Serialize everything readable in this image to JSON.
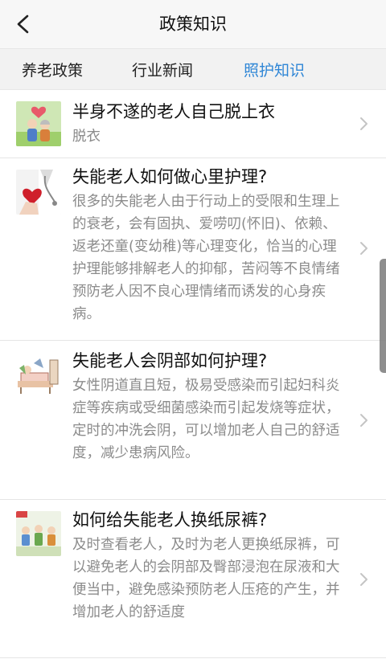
{
  "header": {
    "title": "政策知识",
    "back_icon": "chevron-left-icon"
  },
  "tabs": [
    {
      "label": "养老政策",
      "active": false
    },
    {
      "label": "行业新闻",
      "active": false
    },
    {
      "label": "照护知识",
      "active": true
    }
  ],
  "colors": {
    "accent": "#2f86d6",
    "text": "#111111",
    "muted": "#8b8b8b"
  },
  "articles": [
    {
      "title": "半身不遂的老人自己脱上衣",
      "desc": "脱衣",
      "thumb_icon": "elderly-couple-illustration"
    },
    {
      "title": "失能老人如何做心里护理?",
      "desc": "很多的失能老人由于行动上的受限和生理上的衰老，会有固执、爱唠叨(怀旧)、依赖、返老还童(变幼稚)等心理变化，恰当的心理护理能够排解老人的抑郁，苦闷等不良情绪预防老人因不良心理情绪而诱发的心身疾病。",
      "thumb_icon": "doctor-heart-photo"
    },
    {
      "title": "失能老人会阴部如何护理?",
      "desc": "女性阴道直且短，极易受感染而引起妇科炎症等疾病或受细菌感染而引起发烧等症状，定时的冲洗会阴，可以增加老人自己的舒适度，减少患病风险。",
      "thumb_icon": "bed-care-illustration"
    },
    {
      "title": "如何给失能老人换纸尿裤?",
      "desc": "及时查看老人，及时为老人更换纸尿裤，可以避免老人的会阴部及臀部浸泡在尿液和大便当中，避免感染预防老人压疮的产生，并增加老人的舒适度",
      "thumb_icon": "elderly-group-illustration"
    }
  ]
}
